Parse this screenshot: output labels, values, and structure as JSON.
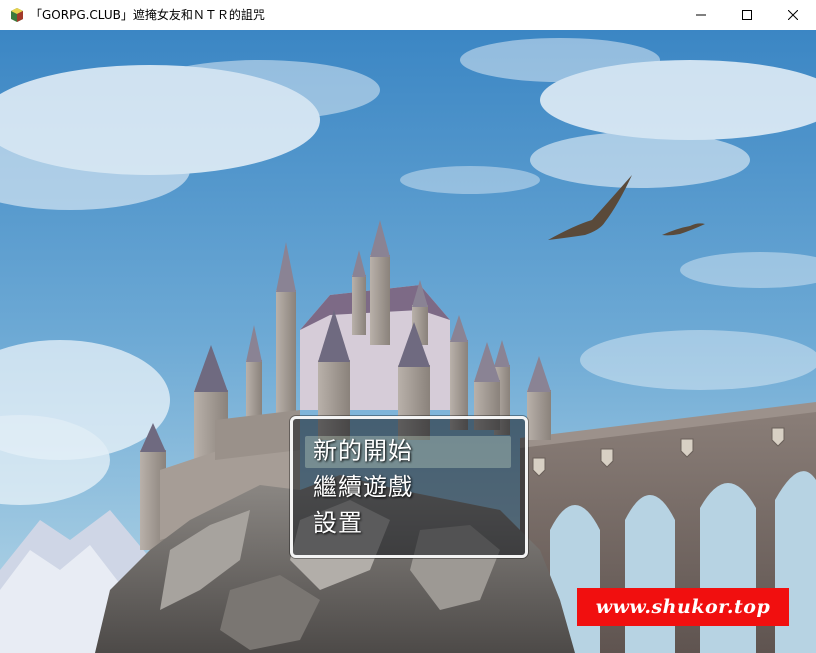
{
  "window": {
    "title": "「GORPG.CLUB」遮掩女友和ＮＴＲ的詛咒",
    "icon": "rpgmaker-icon",
    "controls": [
      "minimize-icon",
      "maximize-icon",
      "close-icon"
    ]
  },
  "menu": {
    "items": [
      {
        "label": "新的開始",
        "selected": true
      },
      {
        "label": "繼續遊戲",
        "selected": false
      },
      {
        "label": "設置",
        "selected": false
      }
    ]
  },
  "watermark": {
    "text": "www.shukor.top",
    "background": "#f10f0f"
  },
  "colors": {
    "sky_top": "#3d88c6",
    "sky_bottom": "#a9cfe2",
    "menu_border": "#f4f4f4"
  }
}
